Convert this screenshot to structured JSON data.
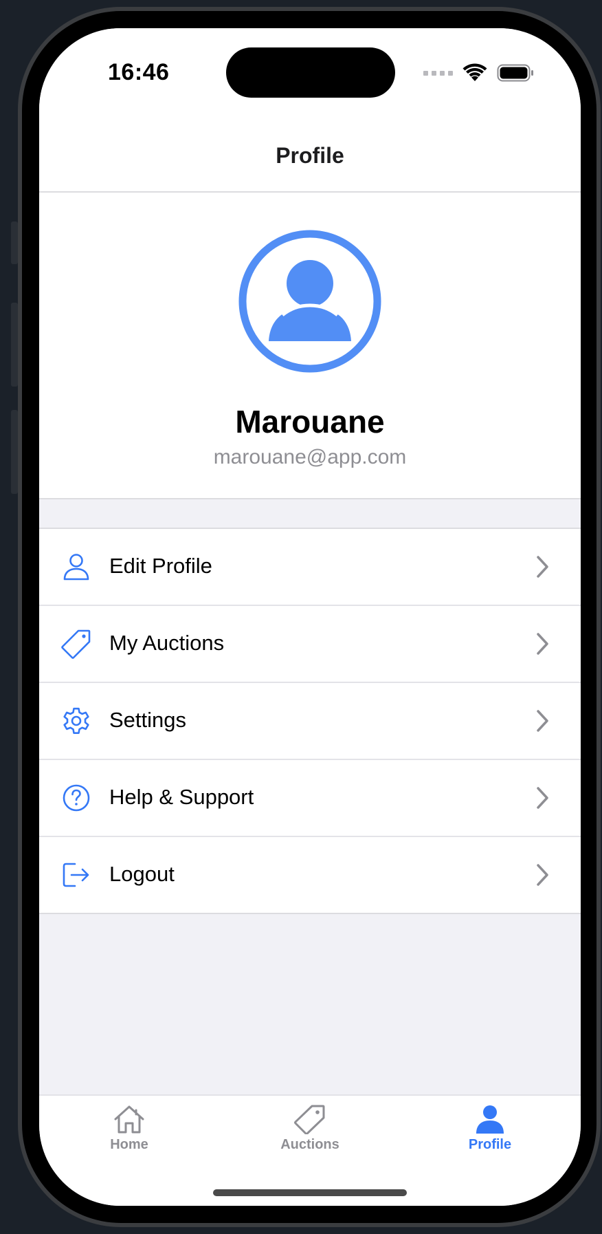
{
  "status": {
    "time": "16:46"
  },
  "nav": {
    "title": "Profile"
  },
  "profile": {
    "name": "Marouane",
    "email": "marouane@app.com"
  },
  "menu": [
    {
      "label": "Edit Profile",
      "icon": "person-icon"
    },
    {
      "label": "My Auctions",
      "icon": "tag-icon"
    },
    {
      "label": "Settings",
      "icon": "gear-icon"
    },
    {
      "label": "Help & Support",
      "icon": "question-circle-icon"
    },
    {
      "label": "Logout",
      "icon": "logout-icon"
    }
  ],
  "tabs": [
    {
      "label": "Home",
      "icon": "house-icon",
      "active": false
    },
    {
      "label": "Auctions",
      "icon": "tag-icon",
      "active": false
    },
    {
      "label": "Profile",
      "icon": "person-fill-icon",
      "active": true
    }
  ],
  "colors": {
    "accent": "#3478f6",
    "avatar": "#528ef5",
    "inactive": "#8e8e93",
    "background": "#f1f1f6"
  }
}
